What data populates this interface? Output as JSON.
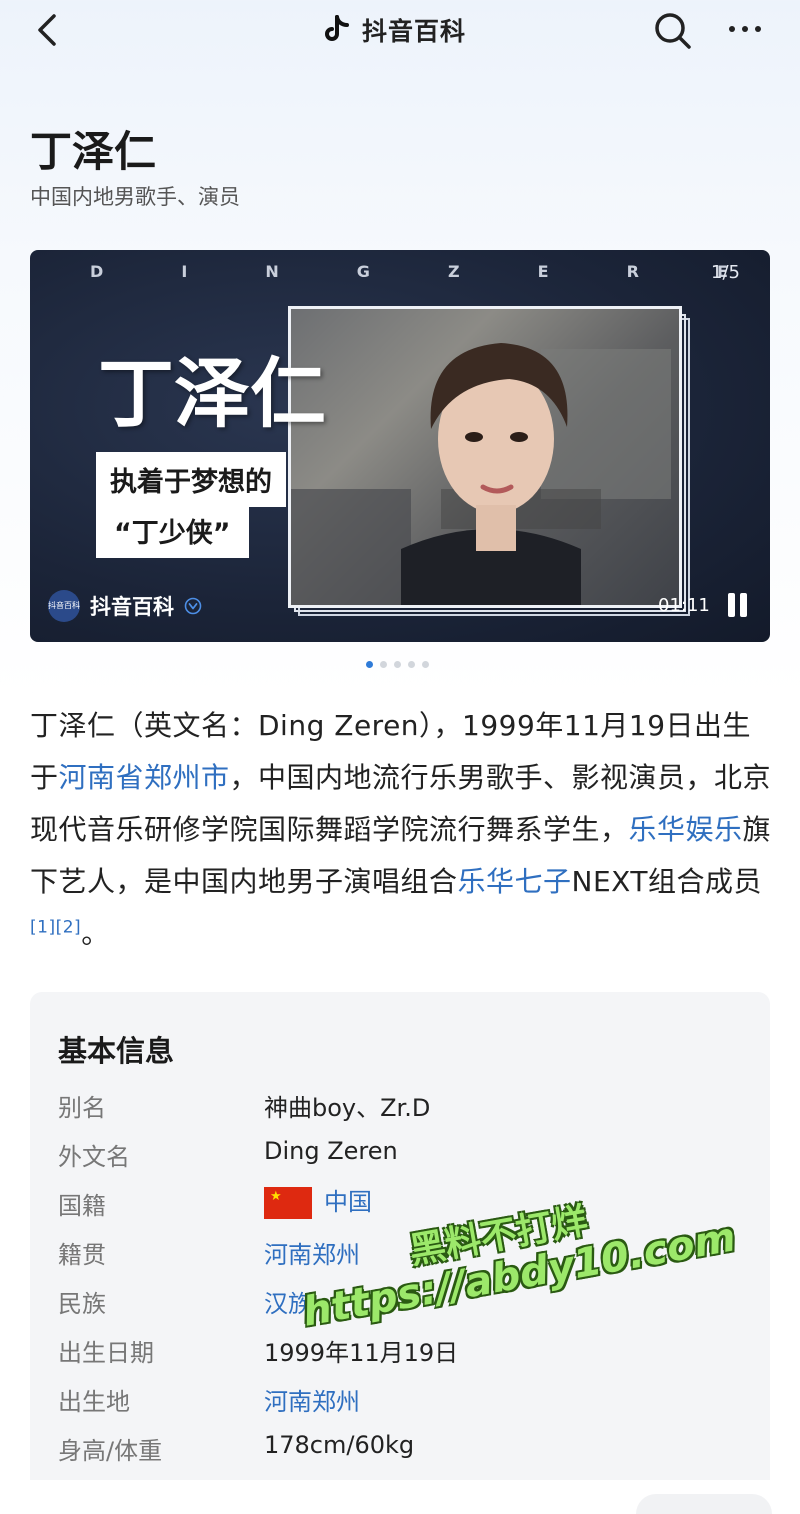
{
  "topbar": {
    "back_icon": "chevron-left-icon",
    "brand_logo_icon": "douyin-note-icon",
    "brand_text": "抖音百科",
    "search_icon": "search-icon",
    "more_icon": "more-horizontal-icon"
  },
  "header": {
    "title": "丁泽仁",
    "subtitle": "中国内地男歌手、演员"
  },
  "video": {
    "letters": [
      "D",
      "I",
      "N",
      "G",
      "Z",
      "E",
      "R",
      "E"
    ],
    "page_counter": "1/5",
    "title": "丁泽仁",
    "tagline_1": "执着于梦想的",
    "tagline_2": "“丁少侠”",
    "brand_logo_text": "抖音百科",
    "brand_text": "抖音百科",
    "time": "01:11",
    "state": "playing"
  },
  "carousel": {
    "count": 5,
    "active_index": 0
  },
  "intro": {
    "p1": "丁泽仁（英文名：Ding Zeren），1999年11月19日出生于",
    "link1": "河南省郑州市",
    "p2": "，中国内地流行乐男歌手、影视演员，北京现代音乐研修学院国际舞蹈学院流行舞系学生，",
    "link2": "乐华娱乐",
    "p3": "旗下艺人，是中国内地男子演唱组合",
    "link3": "乐华七子",
    "p4": "NEXT组合成员",
    "ref1": "[1]",
    "ref2": "[2]",
    "p5": "。"
  },
  "infobox": {
    "title": "基本信息",
    "rows": [
      {
        "label": "别名",
        "value": "神曲boy、Zr.D"
      },
      {
        "label": "外文名",
        "value": "Ding Zeren"
      },
      {
        "label": "国籍",
        "value": "中国"
      },
      {
        "label": "籍贯",
        "value": "河南郑州"
      },
      {
        "label": "民族",
        "value": "汉族"
      },
      {
        "label": "出生日期",
        "value": "1999年11月19日"
      },
      {
        "label": "出生地",
        "value": "河南郑州"
      },
      {
        "label": "身高/体重",
        "value": "178cm/60kg"
      }
    ]
  },
  "watermark": {
    "line1": "黑料不打烊",
    "line2": "https://abdy10.com"
  },
  "colors": {
    "link": "#2f6fc0",
    "carousel_active": "#2f7bd8",
    "watermark_fill": "#9ce86a"
  }
}
